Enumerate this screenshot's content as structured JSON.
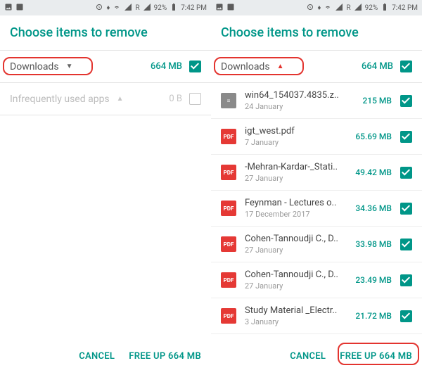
{
  "status": {
    "battery_pct": "92%",
    "time": "7:42 PM",
    "network_label": "R"
  },
  "title": "Choose items to remove",
  "left_pane": {
    "downloads": {
      "label": "Downloads",
      "size": "664 MB",
      "checked": true,
      "expanded": false
    },
    "apps": {
      "label": "Infrequently used apps",
      "size": "0 B",
      "checked": false
    }
  },
  "right_pane": {
    "downloads": {
      "label": "Downloads",
      "size": "664 MB",
      "checked": true,
      "expanded": true
    },
    "items": [
      {
        "icon": "zip",
        "name": "win64_154037.4835.z..",
        "date": "24 January",
        "size": "215 MB",
        "checked": true
      },
      {
        "icon": "pdf",
        "name": "igt_west.pdf",
        "date": "7 January",
        "size": "65.69 MB",
        "checked": true
      },
      {
        "icon": "pdf",
        "name": "-Mehran-Kardar-_Stati..",
        "date": "27 January",
        "size": "49.42 MB",
        "checked": true
      },
      {
        "icon": "pdf",
        "name": "Feynman - Lectures o..",
        "date": "17 December 2017",
        "size": "34.36 MB",
        "checked": true
      },
      {
        "icon": "pdf",
        "name": "Cohen-Tannoudji C., D..",
        "date": "27 January",
        "size": "33.98 MB",
        "checked": true
      },
      {
        "icon": "pdf",
        "name": "Cohen-Tannoudji C., D..",
        "date": "27 January",
        "size": "23.49 MB",
        "checked": true
      },
      {
        "icon": "pdf",
        "name": "Study Material _Electr..",
        "date": "3 January",
        "size": "21.72 MB",
        "checked": true
      }
    ]
  },
  "buttons": {
    "cancel": "CANCEL",
    "confirm": "FREE UP 664 MB"
  },
  "icons": {
    "zip_glyph": "≡",
    "pdf_glyph": "PDF"
  }
}
